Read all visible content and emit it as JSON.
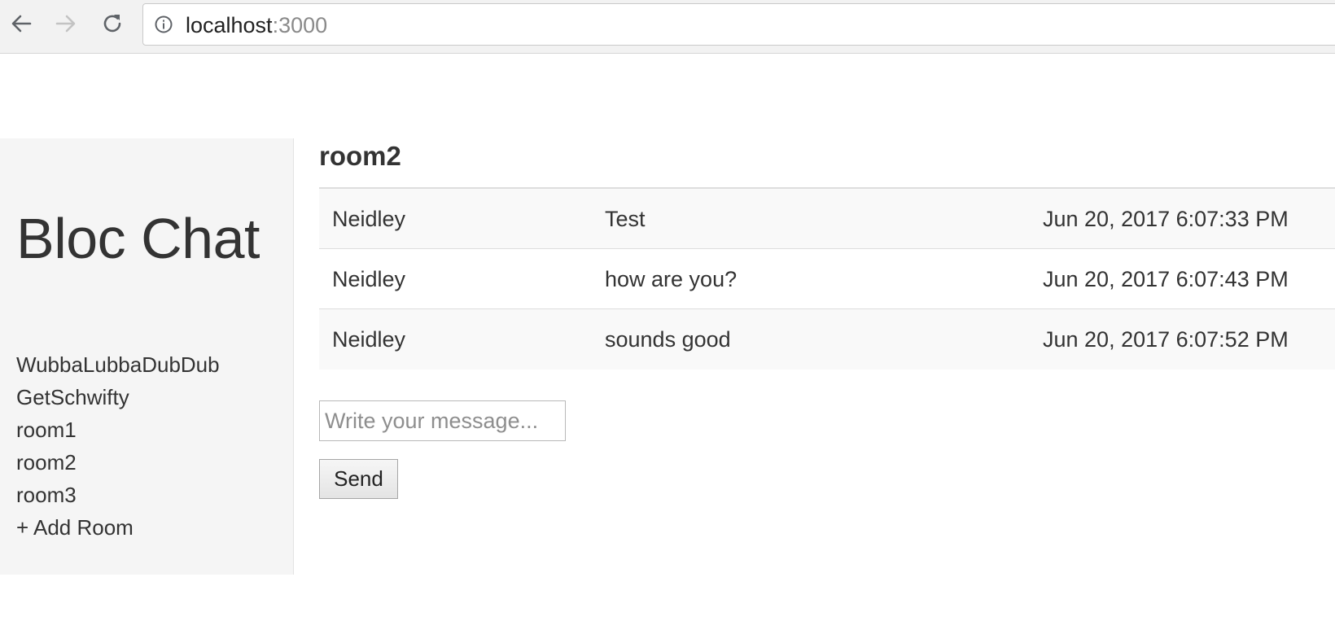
{
  "browser": {
    "url_host": "localhost",
    "url_port": ":3000",
    "icons": {
      "back": "arrow-left-icon",
      "forward": "arrow-right-icon",
      "reload": "reload-icon",
      "info": "info-icon"
    }
  },
  "sidebar": {
    "title": "Bloc Chat",
    "rooms": [
      {
        "label": "WubbaLubbaDubDub"
      },
      {
        "label": "GetSchwifty"
      },
      {
        "label": "room1"
      },
      {
        "label": "room2"
      },
      {
        "label": "room3"
      }
    ],
    "add_room_label": "+ Add Room"
  },
  "main": {
    "room_name": "room2",
    "messages": [
      {
        "user": "Neidley",
        "text": "Test",
        "time": "Jun 20, 2017 6:07:33 PM"
      },
      {
        "user": "Neidley",
        "text": "how are you?",
        "time": "Jun 20, 2017 6:07:43 PM"
      },
      {
        "user": "Neidley",
        "text": "sounds good",
        "time": "Jun 20, 2017 6:07:52 PM"
      }
    ],
    "input_placeholder": "Write your message...",
    "input_value": "",
    "send_label": "Send"
  },
  "colors": {
    "sidebar_bg": "#f5f5f5",
    "text": "#333333",
    "row_stripe": "#f9f9f9",
    "border": "#dddddd"
  }
}
